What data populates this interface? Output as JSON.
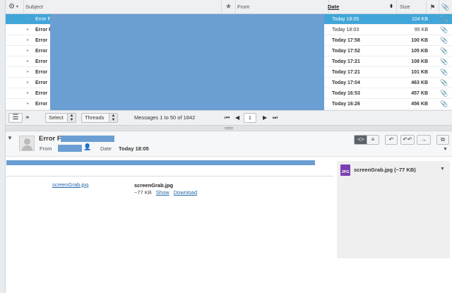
{
  "list_header": {
    "subject": "Subject",
    "from": "From",
    "date": "Date",
    "size": "Size"
  },
  "rows": [
    {
      "subject": "Error F",
      "date": "Today 18:05",
      "size": "104 KB",
      "state": "sel"
    },
    {
      "subject": "Error F",
      "date": "Today 18:03",
      "size": "95 KB",
      "state": "plain"
    },
    {
      "subject": "Error",
      "date": "Today 17:58",
      "size": "100 KB",
      "state": "bold"
    },
    {
      "subject": "Error",
      "date": "Today 17:52",
      "size": "105 KB",
      "state": "bold"
    },
    {
      "subject": "Error",
      "date": "Today 17:21",
      "size": "108 KB",
      "state": "bold"
    },
    {
      "subject": "Error",
      "date": "Today 17:21",
      "size": "101 KB",
      "state": "bold"
    },
    {
      "subject": "Error",
      "date": "Today 17:04",
      "size": "463 KB",
      "state": "bold"
    },
    {
      "subject": "Error",
      "date": "Today 16:53",
      "size": "457 KB",
      "state": "bold"
    },
    {
      "subject": "Error",
      "date": "Today 16:26",
      "size": "456 KB",
      "state": "bold"
    }
  ],
  "toolbar": {
    "select": "Select",
    "threads": "Threads",
    "count": "Messages 1 to 50 of 1842",
    "page": "1"
  },
  "preview": {
    "subject": "Error F",
    "from_label": "From",
    "date_label": "Date",
    "date_value": "Today 18:05",
    "attachment_link": "screenGrab.jpg",
    "attachment_name": "screenGrab.jpg",
    "attachment_size": "~77 KB",
    "show": "Show",
    "download": "Download",
    "side_attachment": "screenGrab.jpg (~77 KB)",
    "jpg_badge": "JPG"
  },
  "colors": {
    "selected_row": "#41a5d8",
    "redaction": "#6b9ed3",
    "link": "#1f66a8"
  }
}
